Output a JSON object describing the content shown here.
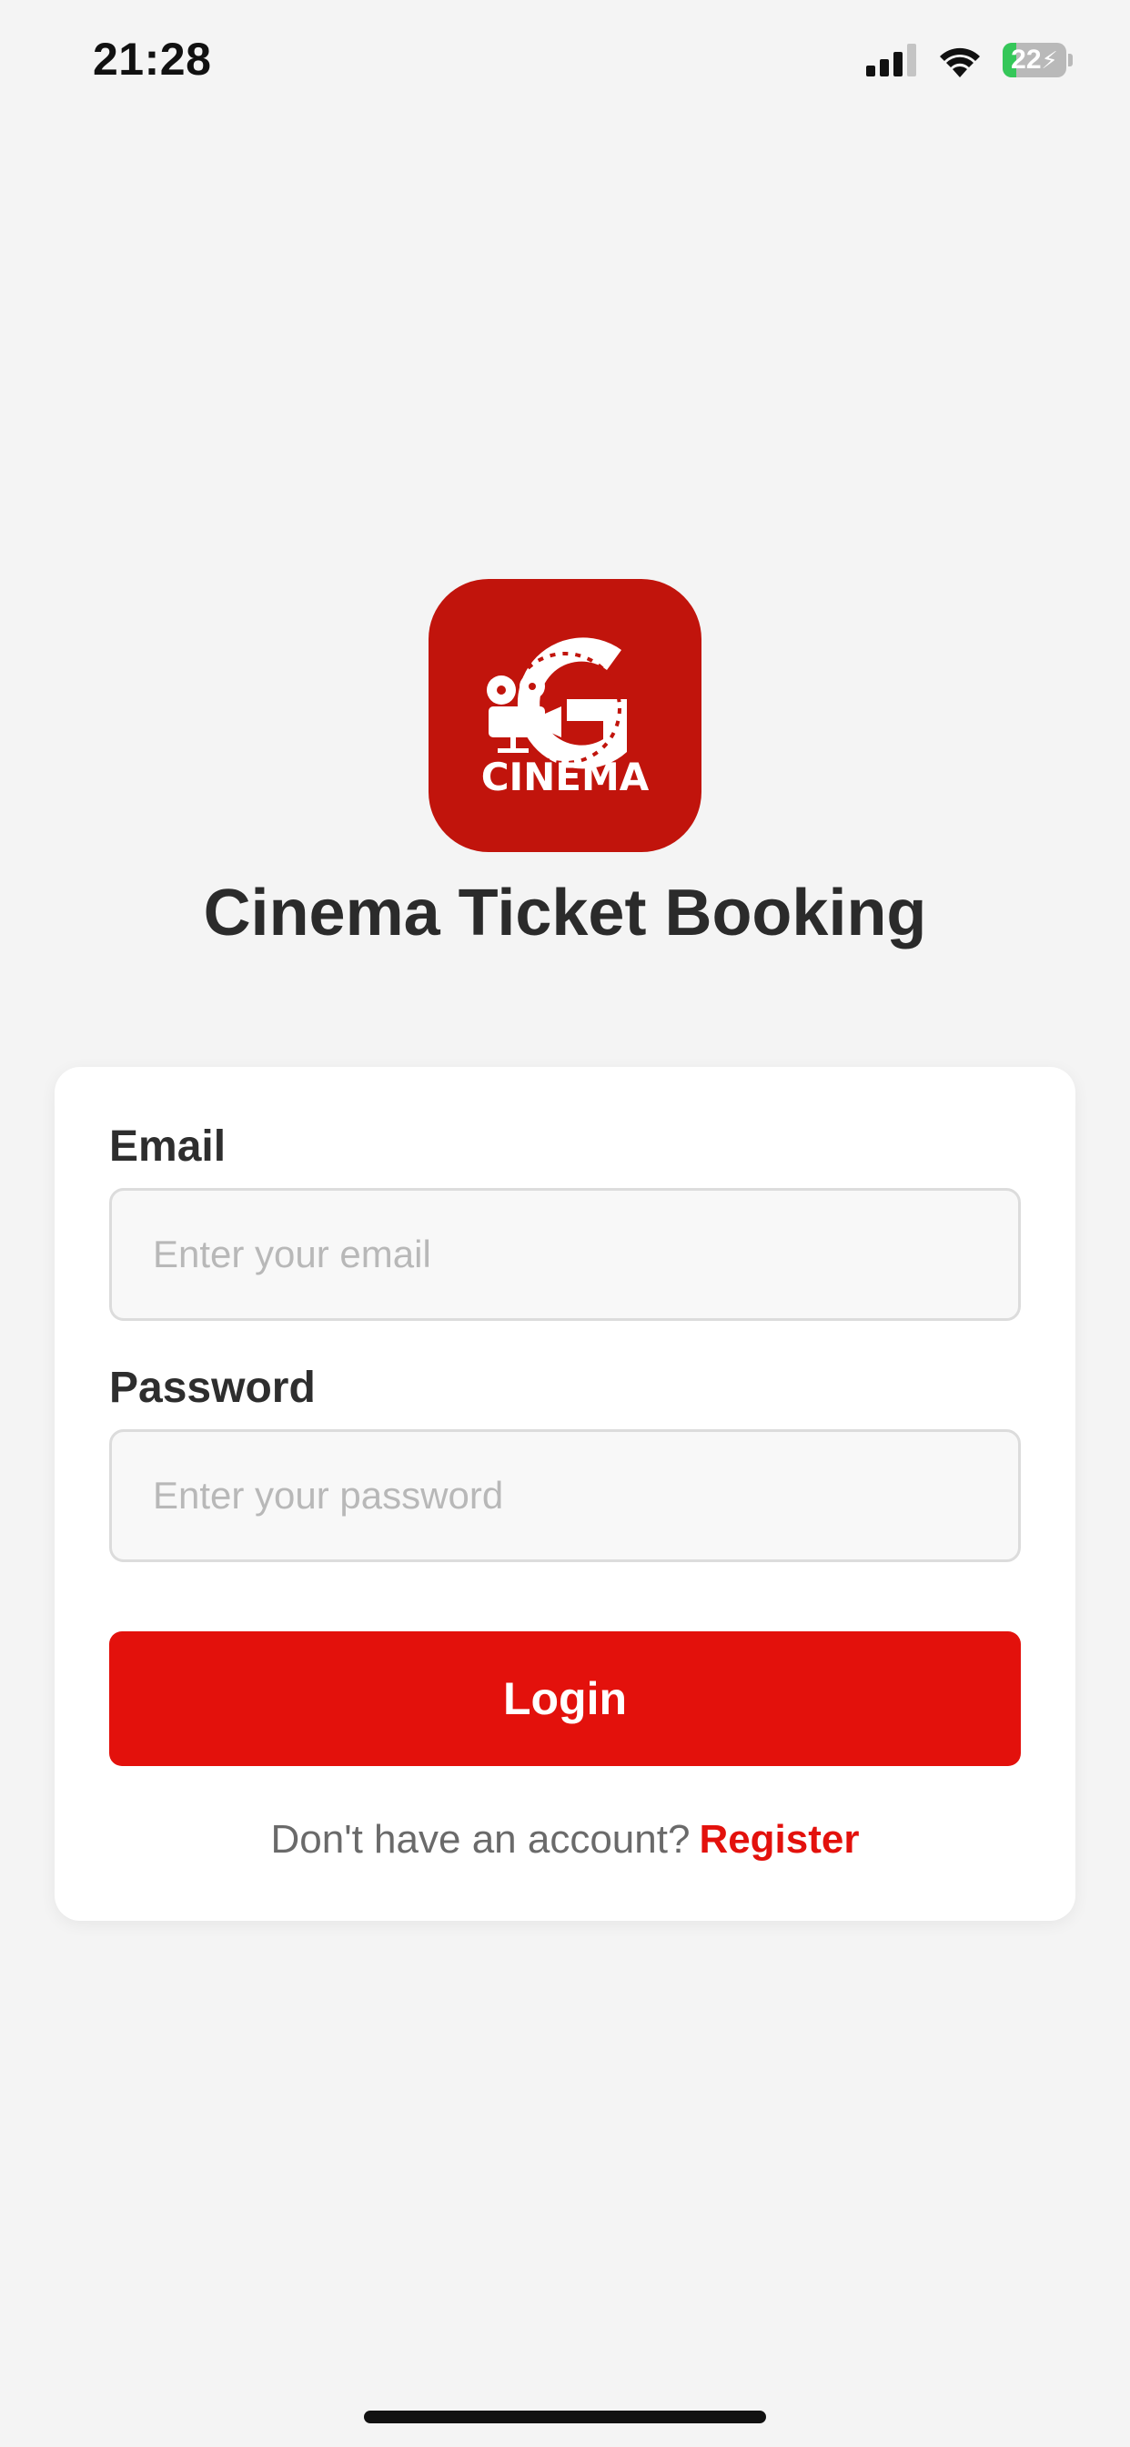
{
  "status_bar": {
    "time": "21:28",
    "battery_percent": "22",
    "battery_level": 0.22,
    "icons": [
      "signal-bars-icon",
      "wifi-icon",
      "battery-charging-icon"
    ]
  },
  "logo": {
    "text": "CINEMA",
    "icon": "cinema-projector-film-g-logo",
    "background_color": "#c1140c"
  },
  "app": {
    "title": "Cinema Ticket Booking"
  },
  "form": {
    "email": {
      "label": "Email",
      "placeholder": "Enter your email",
      "value": ""
    },
    "password": {
      "label": "Password",
      "placeholder": "Enter your password",
      "value": ""
    },
    "login_label": "Login",
    "register_prompt": "Don't have an account?",
    "register_label": "Register"
  },
  "colors": {
    "accent": "#e3110c",
    "background": "#f4f4f4",
    "card": "#ffffff"
  }
}
